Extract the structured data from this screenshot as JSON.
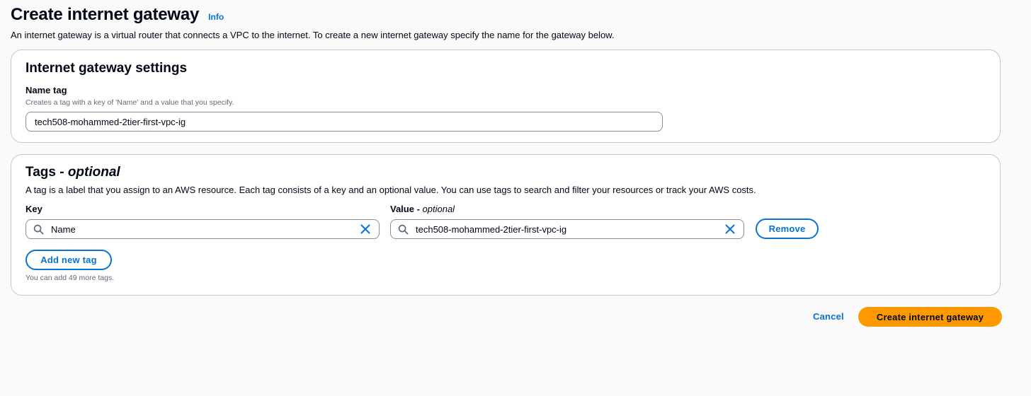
{
  "header": {
    "title": "Create internet gateway",
    "info_label": "Info",
    "description": "An internet gateway is a virtual router that connects a VPC to the internet. To create a new internet gateway specify the name for the gateway below."
  },
  "settings": {
    "title": "Internet gateway settings",
    "name_tag_label": "Name tag",
    "name_tag_hint": "Creates a tag with a key of 'Name' and a value that you specify.",
    "name_tag_value": "tech508-mohammed-2tier-first-vpc-ig"
  },
  "tags": {
    "title": "Tags - ",
    "title_optional": "optional",
    "description": "A tag is a label that you assign to an AWS resource. Each tag consists of a key and an optional value. You can use tags to search and filter your resources or track your AWS costs.",
    "key_label": "Key",
    "value_label": "Value - ",
    "value_label_optional": "optional",
    "rows": [
      {
        "key": "Name",
        "value": "tech508-mohammed-2tier-first-vpc-ig",
        "remove_label": "Remove"
      }
    ],
    "add_label": "Add new tag",
    "remaining_note": "You can add 49 more tags."
  },
  "footer": {
    "cancel_label": "Cancel",
    "create_label": "Create internet gateway"
  },
  "colors": {
    "link": "#0972d3",
    "primary_button": "#ff9900",
    "background": "#fafafa",
    "border": "#c6c6cd"
  },
  "icons": [
    "search-icon",
    "close-icon"
  ]
}
